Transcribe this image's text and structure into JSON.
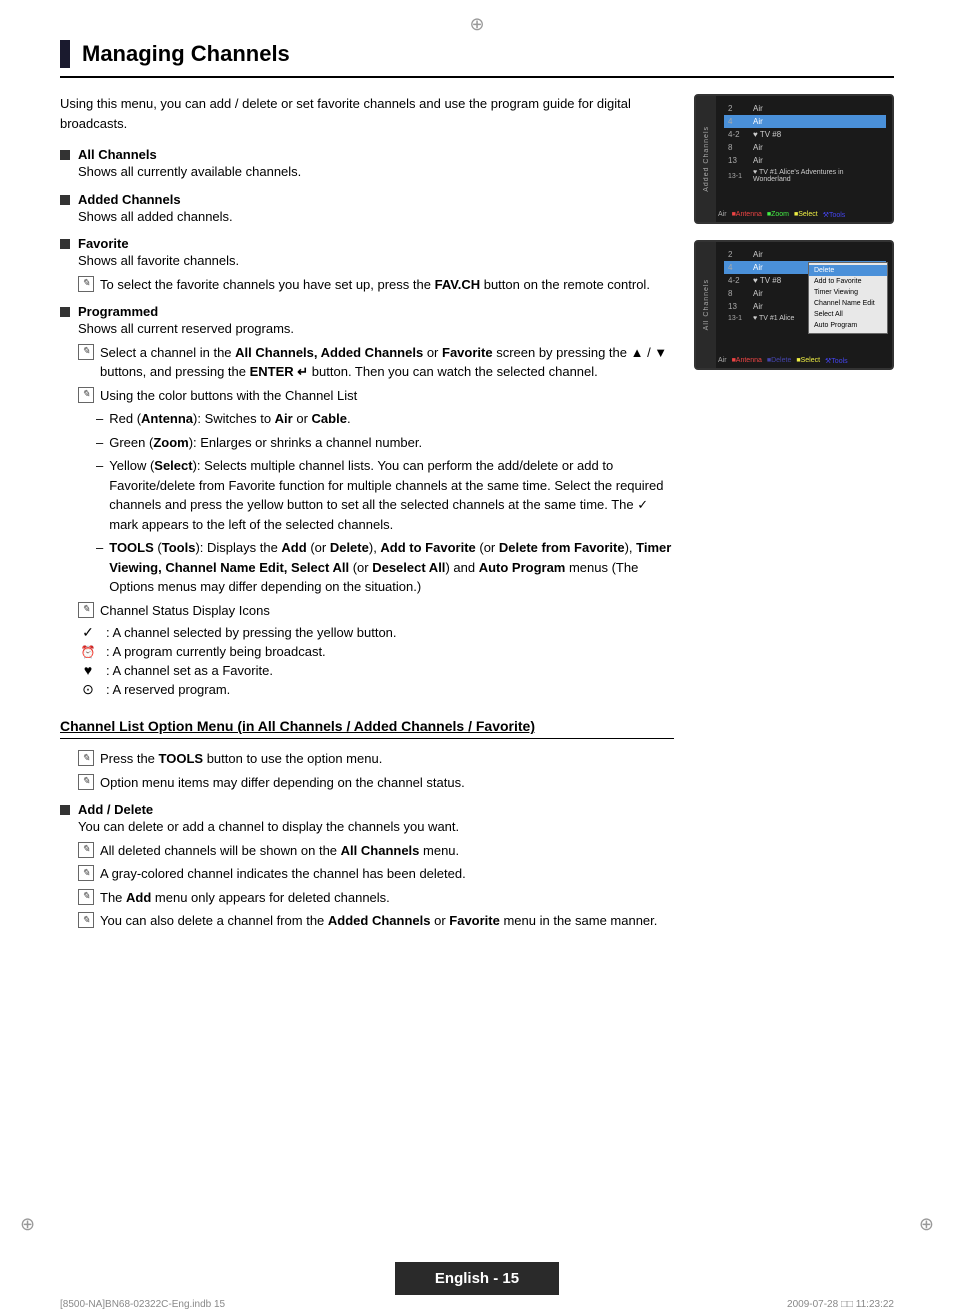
{
  "page": {
    "title": "Managing Channels",
    "intro": "Using this menu, you can add / delete or set favorite channels and use the program guide for digital broadcasts.",
    "sections": [
      {
        "id": "all-channels",
        "title": "All Channels",
        "description": "Shows all currently available channels."
      },
      {
        "id": "added-channels",
        "title": "Added Channels",
        "description": "Shows all added channels."
      },
      {
        "id": "favorite",
        "title": "Favorite",
        "description": "Shows all favorite channels.",
        "note": "To select the favorite channels you have set up, press the FAV.CH button on the remote control."
      },
      {
        "id": "programmed",
        "title": "Programmed",
        "description": "Shows all current reserved programs."
      }
    ],
    "programmed_notes": [
      "Select a channel in the All Channels, Added Channels or Favorite screen by pressing the ▲ / ▼ buttons, and pressing the ENTER  button. Then you can watch the selected channel.",
      "Using the color buttons with the Channel List"
    ],
    "color_buttons": [
      {
        "color": "Red",
        "label": "Antenna",
        "desc": ": Switches to Air or Cable."
      },
      {
        "color": "Green",
        "label": "Zoom",
        "desc": ": Enlarges or shrinks a channel number."
      },
      {
        "color": "Yellow",
        "label": "Select",
        "desc": ": Selects multiple channel lists. You can perform the add/delete or add to Favorite/delete from Favorite function for multiple channels at the same time. Select the required channels and press the yellow button to set all the selected channels at the same time. The ✓ mark appears to the left of the selected channels."
      },
      {
        "color": "–",
        "label": "TOOLS",
        "desc": "(Tools): Displays the Add (or Delete), Add to Favorite (or Delete from Favorite), Timer Viewing, Channel Name Edit, Select All (or Deselect All) and Auto Program menus (The Options menus may differ depending on the situation.)"
      }
    ],
    "channel_status_title": "Channel Status Display Icons",
    "channel_status_icons": [
      {
        "symbol": "✓",
        "desc": ": A channel selected by pressing the yellow button."
      },
      {
        "symbol": "📺",
        "desc": ": A program currently being broadcast."
      },
      {
        "symbol": "♥",
        "desc": ": A channel set as a Favorite."
      },
      {
        "symbol": "⊙",
        "desc": ": A reserved program."
      }
    ],
    "subsection": {
      "title": "Channel List Option Menu (in All Channels / Added Channels / Favorite)",
      "notes": [
        "Press the TOOLS button to use the option menu.",
        "Option menu items may differ depending on the channel status."
      ],
      "add_delete": {
        "title": "Add / Delete",
        "description": "You can delete or add a channel to display the channels you want.",
        "notes": [
          "All deleted channels will be shown on the All Channels menu.",
          "A gray-colored channel indicates the channel has been deleted.",
          "The Add menu only appears for deleted channels.",
          "You can also delete a channel from the Added Channels or Favorite menu in the same manner."
        ]
      }
    }
  },
  "tv1": {
    "sidebar_label": "Added Channels",
    "rows": [
      {
        "num": "2",
        "icon": "",
        "name": "Air",
        "program": "",
        "selected": false
      },
      {
        "num": "4",
        "icon": "📶",
        "name": "Air",
        "program": "",
        "selected": true
      },
      {
        "num": "4-2",
        "icon": "♥ TV #8",
        "name": "",
        "program": "",
        "selected": false
      },
      {
        "num": "8",
        "icon": "",
        "name": "Air",
        "program": "",
        "selected": false
      },
      {
        "num": "13",
        "icon": "",
        "name": "Air",
        "program": "",
        "selected": false
      },
      {
        "num": "13-1",
        "icon": "♥ TV #1",
        "name": "Alice's Adventures in Wonderland",
        "program": "",
        "selected": false
      }
    ],
    "footer": "Air  Antenna  Zoom  Select  Tools"
  },
  "tv2": {
    "sidebar_label": "All Channels",
    "rows": [
      {
        "num": "2",
        "icon": "",
        "name": "Air",
        "program": "",
        "selected": false
      },
      {
        "num": "4",
        "icon": "📶",
        "name": "Air",
        "program": "",
        "selected": true
      },
      {
        "num": "4-2",
        "icon": "♥ TV #8",
        "name": "",
        "program": "",
        "selected": false
      },
      {
        "num": "8",
        "icon": "",
        "name": "Air",
        "program": "",
        "selected": false
      },
      {
        "num": "13",
        "icon": "",
        "name": "Air",
        "program": "",
        "selected": false
      },
      {
        "num": "13-1",
        "icon": "♥ TV #1",
        "name": "Alice",
        "program": "",
        "selected": false
      }
    ],
    "context_menu": [
      {
        "label": "Delete",
        "active": true
      },
      {
        "label": "Add to Favorite",
        "active": false
      },
      {
        "label": "Timer Viewing",
        "active": false
      },
      {
        "label": "Channel Name Edit",
        "active": false
      },
      {
        "label": "Select All",
        "active": false
      },
      {
        "label": "Auto Program",
        "active": false
      }
    ],
    "footer": "Air  Antenna  Delete  Select  Tools"
  },
  "footer": {
    "page_label": "English - 15",
    "file_info": "[8500-NA]BN68-02322C-Eng.indb   15",
    "date_info": "2009-07-28   □□ 11:23:22"
  },
  "crosshair": "⊕"
}
